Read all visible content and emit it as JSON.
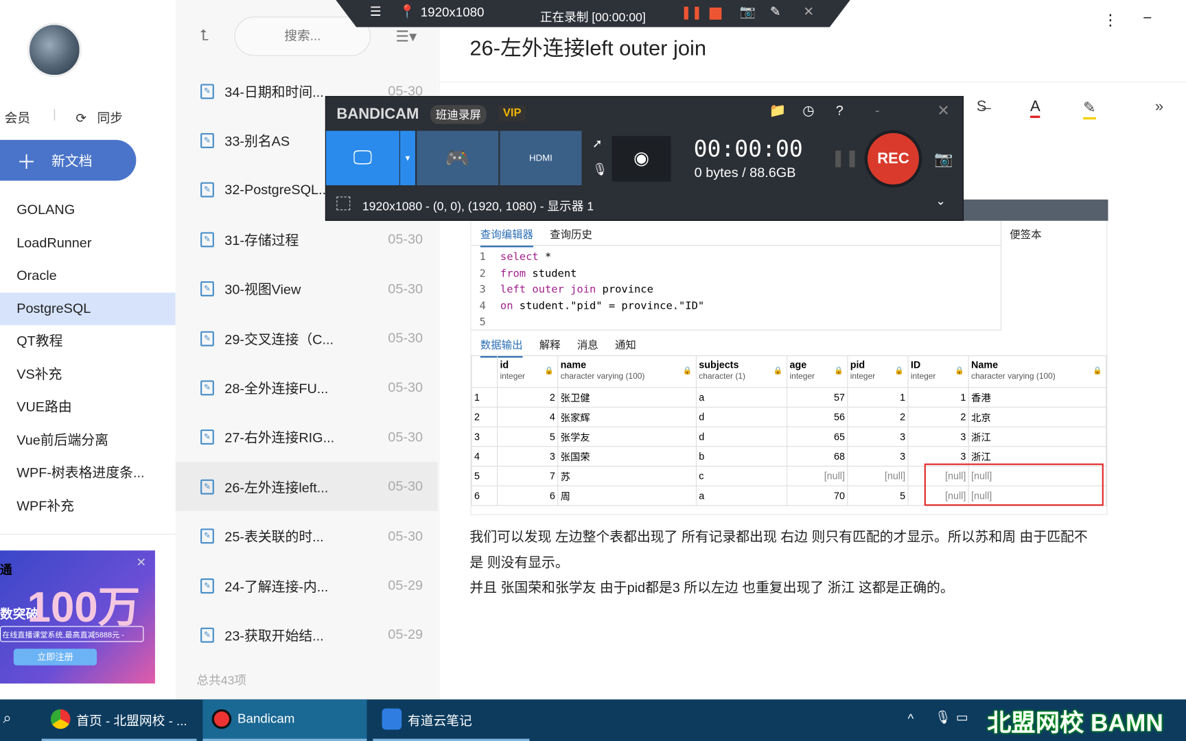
{
  "sidebar": {
    "member": "会员",
    "sync": "同步",
    "new_doc": "新文档",
    "categories": [
      "GOLANG",
      "LoadRunner",
      "Oracle",
      "PostgreSQL",
      "QT教程",
      "VS补充",
      "VUE路由",
      "Vue前后端分离",
      "WPF-树表格进度条...",
      "WPF补充"
    ],
    "active_category": "PostgreSQL",
    "ad": {
      "big": "100万",
      "line1": "通",
      "line2": "数突破",
      "sub": "在线直播课堂系统,最高直减5888元 -",
      "cta": "立即注册"
    }
  },
  "doclist": {
    "search_placeholder": "搜索...",
    "items": [
      {
        "title": "34-日期和时间...",
        "date": "05-30"
      },
      {
        "title": "33-别名AS",
        "date": ""
      },
      {
        "title": "32-PostgreSQL...",
        "date": ""
      },
      {
        "title": "31-存储过程",
        "date": "05-30"
      },
      {
        "title": "30-视图View",
        "date": "05-30"
      },
      {
        "title": "29-交叉连接（C...",
        "date": "05-30"
      },
      {
        "title": "28-全外连接FU...",
        "date": "05-30"
      },
      {
        "title": "27-右外连接RIG...",
        "date": "05-30"
      },
      {
        "title": "26-左外连接left...",
        "date": "05-30"
      },
      {
        "title": "25-表关联的时...",
        "date": "05-30"
      },
      {
        "title": "24-了解连接-内...",
        "date": "05-29"
      },
      {
        "title": "23-获取开始结...",
        "date": "05-29"
      }
    ],
    "total": "总共43项"
  },
  "note": {
    "title": "26-左外连接left outer join",
    "paragraphs": [
      "我们可以发现  左边整个表都出现了 所有记录都出现 右边 则只有匹配的才显示。所以苏和周 由于匹配不",
      "是 则没有显示。",
      "并且 张国荣和张学友 由于pid都是3 所以左边 也重复出现了 浙江 这都是正确的。"
    ]
  },
  "pgadmin": {
    "tabs": [
      "查询编辑器",
      "查询历史"
    ],
    "notepad": "便签本",
    "code": [
      [
        "select",
        " *"
      ],
      [
        "from",
        " student"
      ],
      [
        "left outer join",
        " province"
      ],
      [
        "on",
        " student.\"pid\" = province.\"ID\""
      ],
      [
        "",
        ""
      ]
    ],
    "out_tabs": [
      "数据输出",
      "解释",
      "消息",
      "通知"
    ],
    "columns": [
      {
        "name": "id",
        "type": "integer"
      },
      {
        "name": "name",
        "type": "character varying (100)"
      },
      {
        "name": "subjects",
        "type": "character (1)"
      },
      {
        "name": "age",
        "type": "integer"
      },
      {
        "name": "pid",
        "type": "integer"
      },
      {
        "name": "ID",
        "type": "integer"
      },
      {
        "name": "Name",
        "type": "character varying (100)"
      }
    ],
    "rows": [
      [
        "1",
        "2",
        "张卫健",
        "a",
        "57",
        "1",
        "1",
        "香港"
      ],
      [
        "2",
        "4",
        "张家辉",
        "d",
        "56",
        "2",
        "2",
        "北京"
      ],
      [
        "3",
        "5",
        "张学友",
        "d",
        "65",
        "3",
        "3",
        "浙江"
      ],
      [
        "4",
        "3",
        "张国荣",
        "b",
        "68",
        "3",
        "3",
        "浙江"
      ],
      [
        "5",
        "7",
        "苏",
        "c",
        "[null]",
        "[null]",
        "[null]",
        "[null]"
      ],
      [
        "6",
        "6",
        "周",
        "a",
        "70",
        "5",
        "[null]",
        "[null]"
      ]
    ]
  },
  "recbar": {
    "resolution": "1920x1080",
    "status": "正在录制 [00:00:00]"
  },
  "bandicam": {
    "brand": "BANDICAM",
    "cn": "班迪录屏",
    "vip": "VIP",
    "time": "00:00:00",
    "size": "0 bytes / 88.6GB",
    "rec": "REC",
    "area": "1920x1080 - (0, 0), (1920, 1080) - 显示器 1",
    "hdmi": "HDMI"
  },
  "taskbar": {
    "items": [
      "首页 - 北盟网校 - ...",
      "Bandicam",
      "有道云笔记"
    ],
    "watermark": "北盟网校 BAMN"
  },
  "colors": {
    "accent": "#4a74c9",
    "rec": "#d93a2b",
    "taskbar": "#0c3b5e",
    "highlight": "#e02b2b"
  }
}
